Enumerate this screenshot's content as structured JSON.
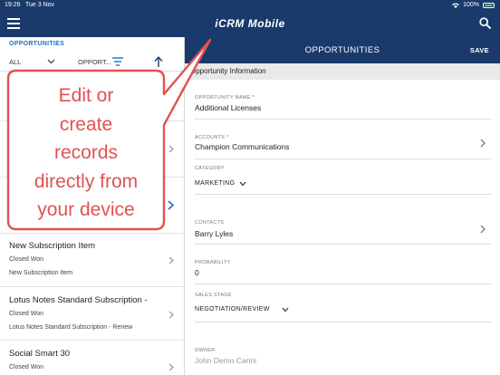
{
  "status_bar": {
    "time": "19:26",
    "date": "Tue 3 Nov",
    "battery": "100%",
    "battery_level": 1.0
  },
  "app": {
    "title": "iCRM Mobile"
  },
  "list": {
    "heading": "OPPORTUNITIES",
    "filter_label": "ALL",
    "sort_label": "OPPORT...",
    "items": [
      {
        "title": "",
        "subtitle": "",
        "detail": ""
      },
      {
        "title": "",
        "subtitle": "",
        "detail": ""
      },
      {
        "title": "",
        "subtitle": "",
        "detail": ""
      },
      {
        "title": "New Subscription Item",
        "subtitle": "Closed Won",
        "detail": "New Subscription Item"
      },
      {
        "title": "Lotus Notes Standard Subscription -",
        "subtitle": "Closed Won",
        "detail": "Lotus Notes Standard Subscription - Renew"
      },
      {
        "title": "Social Smart 30",
        "subtitle": "Closed Won",
        "detail": ""
      }
    ]
  },
  "detail": {
    "title": "OPPORTUNITIES",
    "save_label": "SAVE",
    "section": "Opportunity Information",
    "fields": {
      "opportunity_name": {
        "label": "OPPORTUNITY NAME *",
        "value": "Additional Licenses"
      },
      "accounts": {
        "label": "ACCOUNTS *",
        "value": "Champion Communications"
      },
      "category": {
        "label": "CATEGORY",
        "value": "MARKETING"
      },
      "contacts": {
        "label": "CONTACTS",
        "value": "Barry Lyles"
      },
      "probability": {
        "label": "PROBABILITY",
        "value": "0"
      },
      "sales_stage": {
        "label": "SALES STAGE",
        "value": "NEGOTIATION/REVIEW"
      },
      "owner": {
        "label": "OWNER",
        "value": "John Demo Carini"
      }
    }
  },
  "callout": {
    "lines": [
      "Edit or",
      "create",
      "records",
      "directly from",
      "your device"
    ],
    "color": "#e05353"
  },
  "colors": {
    "navy": "#1a3a6b",
    "accent_blue": "#1a6fc4",
    "callout_red": "#e05353"
  }
}
